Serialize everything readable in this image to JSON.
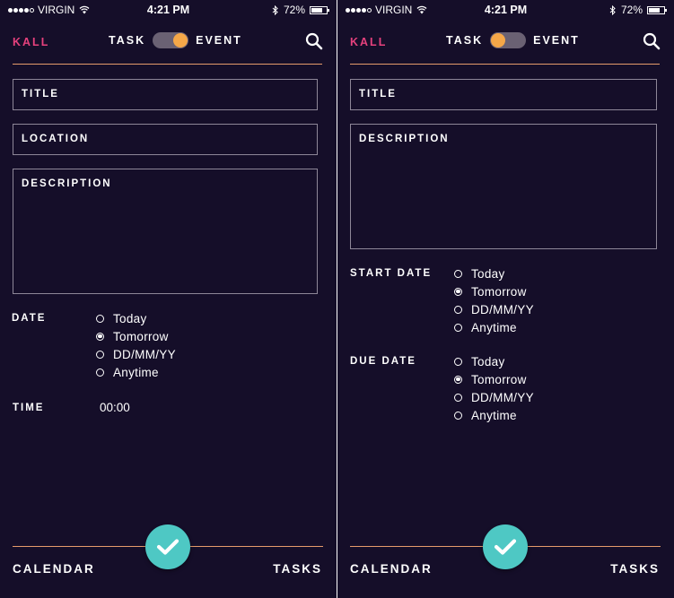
{
  "status": {
    "carrier": "VIRGIN",
    "time": "4:21 PM",
    "battery": "72%"
  },
  "header": {
    "logo": "KALL",
    "task_label": "TASK",
    "event_label": "EVENT"
  },
  "colors": {
    "background": "#150e29",
    "accent_pink": "#e6417d",
    "accent_orange": "#f5a748",
    "divider": "#e59b6b",
    "check_teal": "#4ec8c4"
  },
  "event_screen": {
    "toggle_state": "event",
    "title_label": "TITLE",
    "location_label": "LOCATION",
    "description_label": "DESCRIPTION",
    "date_label": "DATE",
    "date_options": [
      "Today",
      "Tomorrow",
      "DD/MM/YY",
      "Anytime"
    ],
    "date_selected": "Tomorrow",
    "time_label": "TIME",
    "time_value": "00:00"
  },
  "task_screen": {
    "toggle_state": "task",
    "title_label": "TITLE",
    "description_label": "DESCRIPTION",
    "start_date_label": "START DATE",
    "start_options": [
      "Today",
      "Tomorrow",
      "DD/MM/YY",
      "Anytime"
    ],
    "start_selected": "Tomorrow",
    "due_date_label": "DUE DATE",
    "due_options": [
      "Today",
      "Tomorrow",
      "DD/MM/YY",
      "Anytime"
    ],
    "due_selected": "Tomorrow"
  },
  "nav": {
    "calendar_label": "CALENDAR",
    "tasks_label": "TASKS"
  },
  "icons": {
    "search": "search-icon",
    "confirm": "checkmark-icon",
    "wifi": "wifi-icon",
    "bluetooth": "bluetooth-icon",
    "battery": "battery-icon"
  }
}
